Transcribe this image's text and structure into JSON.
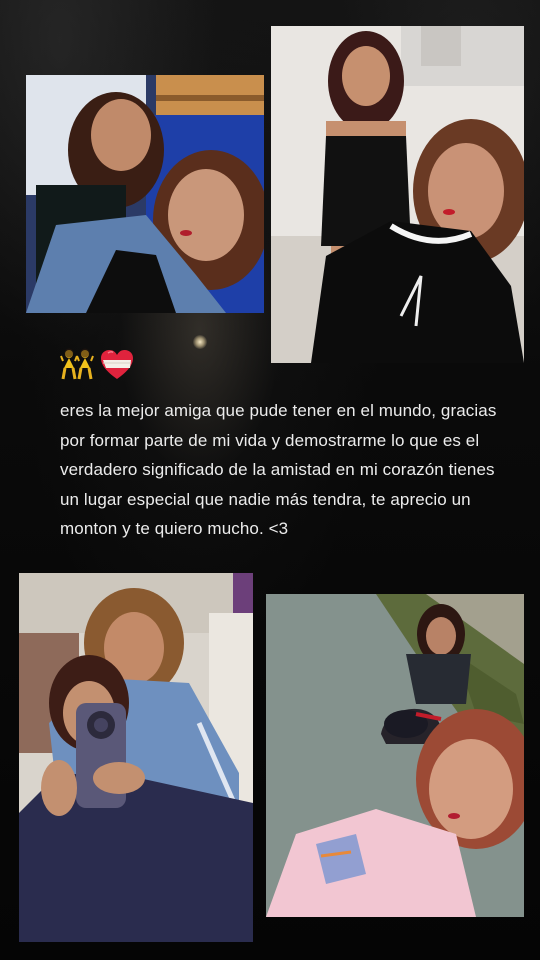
{
  "post": {
    "emojis": [
      "dancers-icon",
      "bandaged-heart-icon"
    ],
    "caption": "eres la mejor amiga que pude tener en el mundo, gracias por formar parte de mi vida y demostrarme lo que es el verdadero significado de la amistad en mi corazón tienes un lugar especial que nadie más tendra, te aprecio un monton y te quiero mucho. <3"
  },
  "colors": {
    "background": "#050505",
    "caption_text": "#ececec"
  }
}
